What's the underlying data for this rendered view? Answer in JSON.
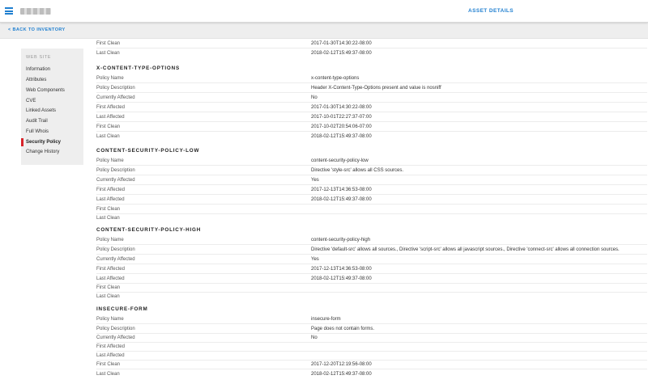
{
  "header": {
    "asset_details_label": "ASSET DETAILS"
  },
  "subnav": {
    "back_label": "< BACK TO INVENTORY"
  },
  "sidebar": {
    "heading": "WEB SITE",
    "items": [
      {
        "label": "Information"
      },
      {
        "label": "Attributes"
      },
      {
        "label": "Web Components"
      },
      {
        "label": "CVE"
      },
      {
        "label": "Linked Assets"
      },
      {
        "label": "Audit Trail"
      },
      {
        "label": "Full Whois"
      },
      {
        "label": "Security Policy"
      },
      {
        "label": "Change History"
      }
    ],
    "active": "Security Policy"
  },
  "content": {
    "top_rows": [
      {
        "label": "First Clean",
        "value": "2017-01-30T14:30:22-08:00"
      },
      {
        "label": "Last Clean",
        "value": "2018-02-12T15:49:37-08:00"
      }
    ],
    "sections": [
      {
        "title": "X-CONTENT-TYPE-OPTIONS",
        "rows": [
          {
            "label": "Policy Name",
            "value": "x-content-type-options"
          },
          {
            "label": "Policy Description",
            "value": "Header X-Content-Type-Options present and value is nosniff"
          },
          {
            "label": "Currently Affected",
            "value": "No"
          },
          {
            "label": "First Affected",
            "value": "2017-01-30T14:30:22-08:00"
          },
          {
            "label": "Last Affected",
            "value": "2017-10-01T22:27:37-07:00"
          },
          {
            "label": "First Clean",
            "value": "2017-10-02T20:54:06-07:00"
          },
          {
            "label": "Last Clean",
            "value": "2018-02-12T15:49:37-08:00"
          }
        ]
      },
      {
        "title": "CONTENT-SECURITY-POLICY-LOW",
        "rows": [
          {
            "label": "Policy Name",
            "value": "content-security-policy-low"
          },
          {
            "label": "Policy Description",
            "value": "Directive 'style-src' allows all CSS sources."
          },
          {
            "label": "Currently Affected",
            "value": "Yes"
          },
          {
            "label": "First Affected",
            "value": "2017-12-13T14:36:53-08:00"
          },
          {
            "label": "Last Affected",
            "value": "2018-02-12T15:49:37-08:00"
          },
          {
            "label": "First Clean",
            "value": ""
          },
          {
            "label": "Last Clean",
            "value": ""
          }
        ]
      },
      {
        "title": "CONTENT-SECURITY-POLICY-HIGH",
        "rows": [
          {
            "label": "Policy Name",
            "value": "content-security-policy-high"
          },
          {
            "label": "Policy Description",
            "value": "Directive 'default-src' allows all sources., Directive 'script-src' allows all javascript sources., Directive 'connect-src' allows all connection sources."
          },
          {
            "label": "Currently Affected",
            "value": "Yes"
          },
          {
            "label": "First Affected",
            "value": "2017-12-13T14:36:53-08:00"
          },
          {
            "label": "Last Affected",
            "value": "2018-02-12T15:49:37-08:00"
          },
          {
            "label": "First Clean",
            "value": ""
          },
          {
            "label": "Last Clean",
            "value": ""
          }
        ]
      },
      {
        "title": "INSECURE-FORM",
        "rows": [
          {
            "label": "Policy Name",
            "value": "insecure-form"
          },
          {
            "label": "Policy Description",
            "value": "Page does not contain forms."
          },
          {
            "label": "Currently Affected",
            "value": "No"
          },
          {
            "label": "First Affected",
            "value": ""
          },
          {
            "label": "Last Affected",
            "value": ""
          },
          {
            "label": "First Clean",
            "value": "2017-12-20T12:19:56-08:00"
          },
          {
            "label": "Last Clean",
            "value": "2018-02-12T15:49:37-08:00"
          }
        ]
      }
    ]
  }
}
